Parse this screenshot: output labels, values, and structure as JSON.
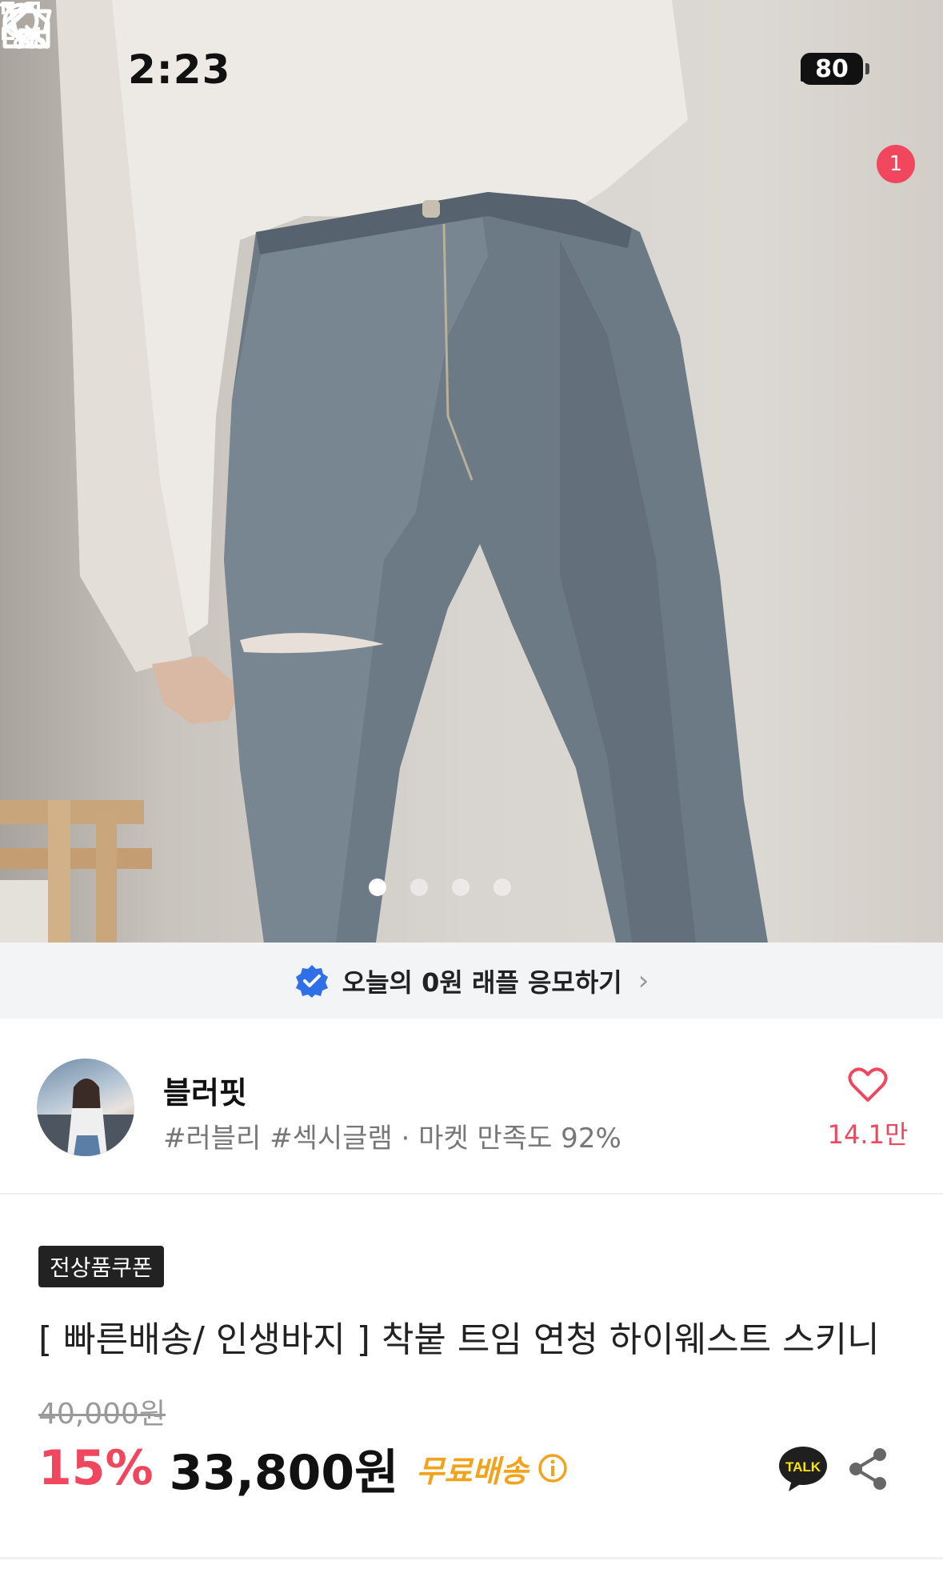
{
  "status_bar": {
    "time": "2:23",
    "battery": "80"
  },
  "header": {
    "cart_count": "1"
  },
  "gallery": {
    "pages": 4,
    "active_page": 1
  },
  "raffle": {
    "text": "오늘의 0원 래플 응모하기",
    "chevron": "›"
  },
  "store": {
    "name": "블러핏",
    "tags": "#러블리 #섹시글램 · 마켓 만족도 92%",
    "likes": "14.1만"
  },
  "product": {
    "coupon_badge": "전상품쿠폰",
    "title": "[ 빠른배송/ 인생바지 ] 착붙 트임 연청 하이웨스트 스키니",
    "original_price": "40,000원",
    "discount": "15%",
    "price": "33,800원",
    "shipping": "무료배송",
    "talk_label": "TALK"
  },
  "colors": {
    "accent": "#f0475f",
    "shipping": "#f3a21c",
    "verify": "#2f6fe8",
    "kakao": "#fee500"
  },
  "icons": [
    "back-icon",
    "home-icon",
    "search-icon",
    "cart-icon",
    "expand-icon",
    "verified-check-icon",
    "heart-icon",
    "info-icon",
    "kakao-talk-icon",
    "share-icon"
  ]
}
